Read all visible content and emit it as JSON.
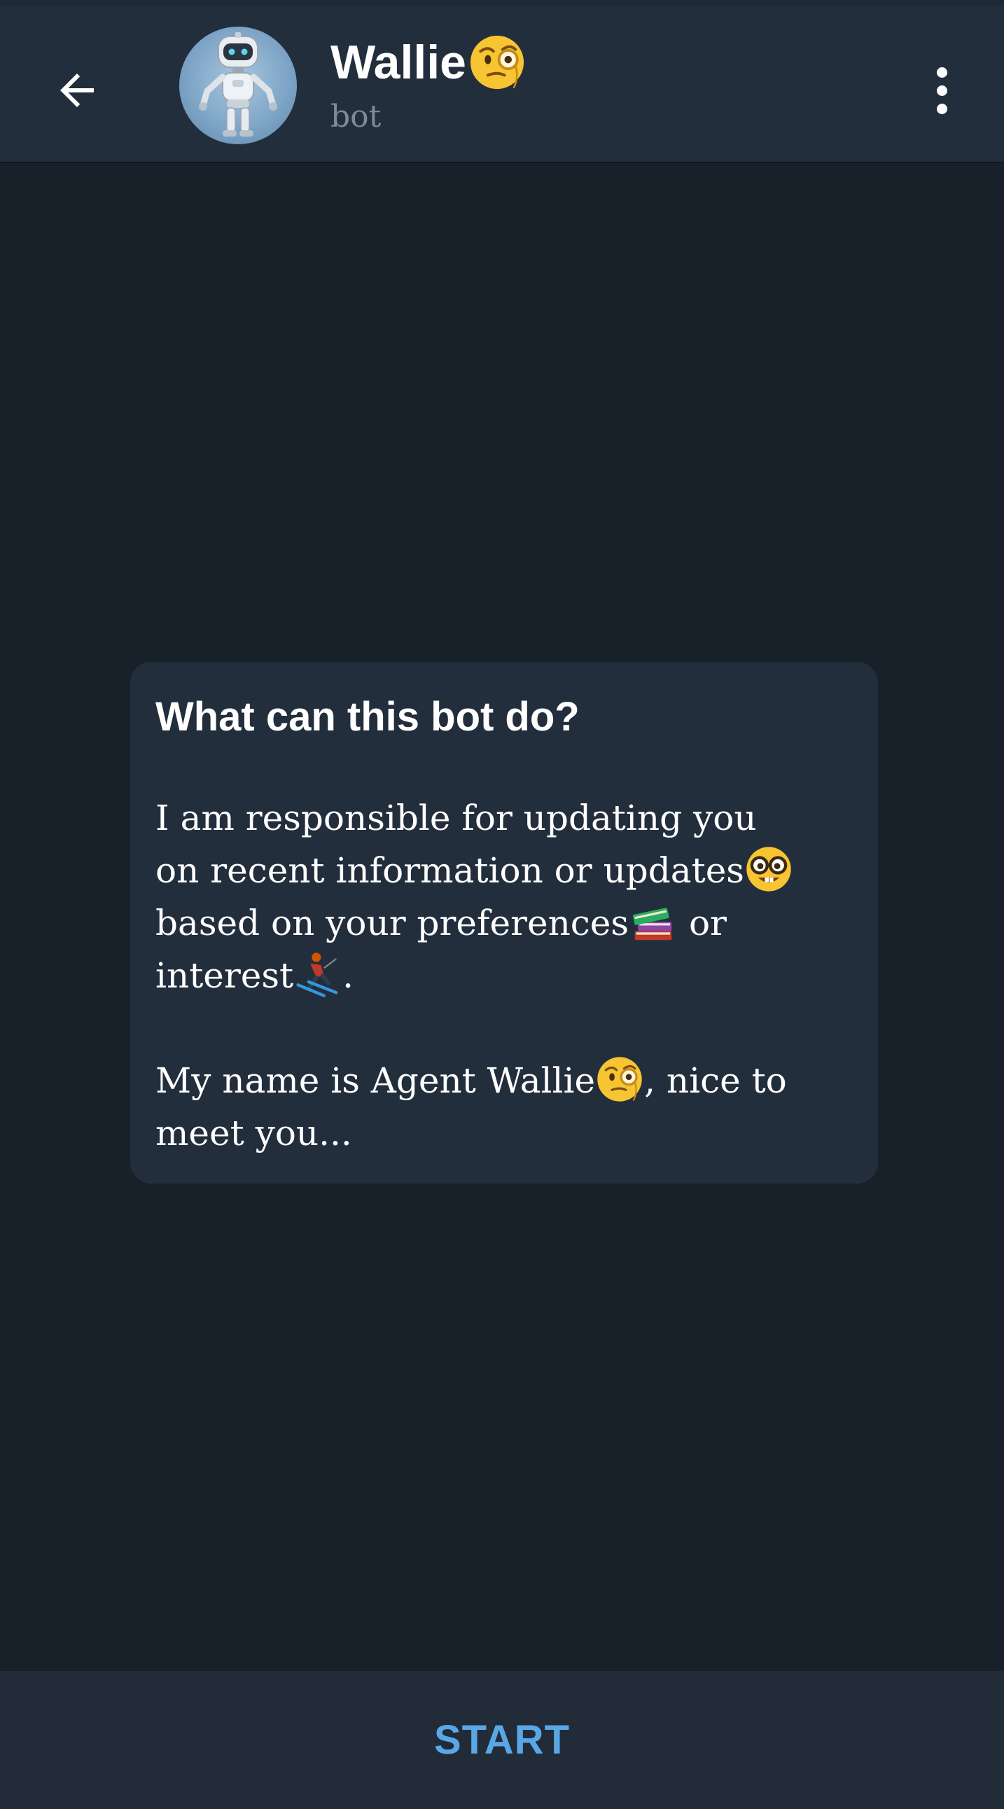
{
  "header": {
    "back_icon": "arrow-left-icon",
    "title": "Wallie",
    "title_emoji": "face-with-monocle-icon",
    "subtitle": "bot",
    "menu_icon": "more-vertical-icon"
  },
  "intro_card": {
    "heading": "What can this bot do?",
    "para1": {
      "line1": "I am responsible for updating you",
      "line2_text": "on recent information or updates",
      "line2_emoji": "nerd-face-icon",
      "line3_text": "based on your preferences",
      "line3_emoji": "books-icon",
      "line3_tail": " or",
      "line4_text": "interest",
      "line4_emoji": "skier-icon",
      "line4_tail": "."
    },
    "para2": {
      "line1_text": "My name is Agent Wallie",
      "line1_emoji": "face-with-monocle-icon",
      "line1_tail": ", nice to",
      "line2": "meet you..."
    }
  },
  "footer": {
    "start_label": "START"
  },
  "colors": {
    "background": "#18202a",
    "header_bg": "#232e3c",
    "card_bg": "#232e3c",
    "accent": "#5aa7e6",
    "muted_text": "#7d8b99"
  }
}
